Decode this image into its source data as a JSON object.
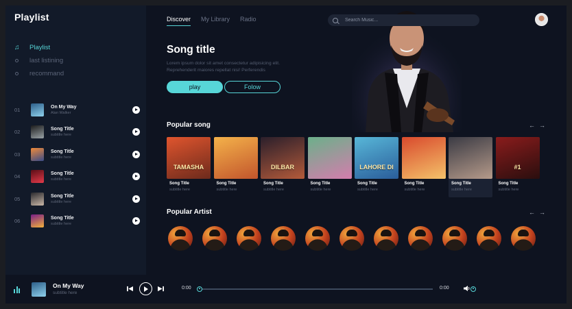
{
  "app": {
    "title": "Playlist"
  },
  "sidebar": {
    "nav": [
      {
        "label": "Playlist",
        "active": true,
        "icon": "music-note-icon"
      },
      {
        "label": "last listining",
        "active": false,
        "icon": "dot-icon"
      },
      {
        "label": "recommand",
        "active": false,
        "icon": "dot-icon"
      }
    ],
    "playlist": [
      {
        "num": "01",
        "title": "On My Way",
        "subtitle": "Alan Walker",
        "cover": [
          "#2d5f8a",
          "#8fd1ec"
        ]
      },
      {
        "num": "02",
        "title": "Song Title",
        "subtitle": "subtitle here",
        "cover": [
          "#1c1c1c",
          "#9aa3a7"
        ]
      },
      {
        "num": "03",
        "title": "Song Title",
        "subtitle": "subtitle here",
        "cover": [
          "#f08a3a",
          "#3a4c88"
        ]
      },
      {
        "num": "04",
        "title": "Song Title",
        "subtitle": "subtitle here",
        "cover": [
          "#5a0e16",
          "#e33a4a"
        ]
      },
      {
        "num": "05",
        "title": "Song Title",
        "subtitle": "subtitle here",
        "cover": [
          "#2a2a2e",
          "#c9b7a7"
        ]
      },
      {
        "num": "06",
        "title": "Song Title",
        "subtitle": "subtitle here",
        "cover": [
          "#7a1f87",
          "#f2b13c"
        ]
      }
    ]
  },
  "header": {
    "tabs": [
      {
        "label": "Discover",
        "active": true
      },
      {
        "label": "My Library",
        "active": false
      },
      {
        "label": "Radio",
        "active": false
      }
    ],
    "search_placeholder": "Search Music..."
  },
  "hero": {
    "title": "Song title",
    "description": "Lorem ipsum dolor sit amet consectetur adipisicing elit. Reprehenderit maiores repellat nisi! Perferendis",
    "play_label": "play",
    "follow_label": "Folow"
  },
  "popular_songs": {
    "title": "Popular song",
    "prev_icon": "arrow-left-icon",
    "next_icon": "arrow-right-icon",
    "items": [
      {
        "title": "Song Title",
        "subtitle": "subtitle here",
        "cover_text": "TAMASHA",
        "cover": [
          "#e0552e",
          "#6c2a1c"
        ]
      },
      {
        "title": "Song Title",
        "subtitle": "subtitle here",
        "cover_text": "",
        "cover": [
          "#f4b24a",
          "#c2552c"
        ]
      },
      {
        "title": "Song Title",
        "subtitle": "subtitle here",
        "cover_text": "DILBAR",
        "cover": [
          "#2b1f2b",
          "#b35a3a"
        ]
      },
      {
        "title": "Song Title",
        "subtitle": "subtitle here",
        "cover_text": "",
        "cover": [
          "#6bb08a",
          "#d47dad"
        ]
      },
      {
        "title": "Song Title",
        "subtitle": "subtitle here",
        "cover_text": "LAHORE DI",
        "cover": [
          "#58b7d8",
          "#2a5d9a"
        ]
      },
      {
        "title": "Song Title",
        "subtitle": "subtitle here",
        "cover_text": "",
        "cover": [
          "#d94a2d",
          "#f4c26a"
        ]
      },
      {
        "title": "Song Title",
        "subtitle": "subtitle here",
        "cover_text": "",
        "cover": [
          "#3b3b44",
          "#b59a8a"
        ],
        "highlight": true
      },
      {
        "title": "Song Title",
        "subtitle": "subtitle here",
        "cover_text": "#1",
        "cover": [
          "#8a1c1c",
          "#2a0e0e"
        ]
      }
    ]
  },
  "popular_artists": {
    "title": "Popular Artist",
    "prev_icon": "arrow-left-icon",
    "next_icon": "arrow-right-icon",
    "count": 11
  },
  "player": {
    "track_title": "On My Way",
    "track_subtitle": "subtitle here",
    "time_current": "0:00",
    "time_total": "0:00",
    "progress_fraction": 0.0,
    "volume_fraction": 0.0,
    "accent": "#57d6d8"
  }
}
